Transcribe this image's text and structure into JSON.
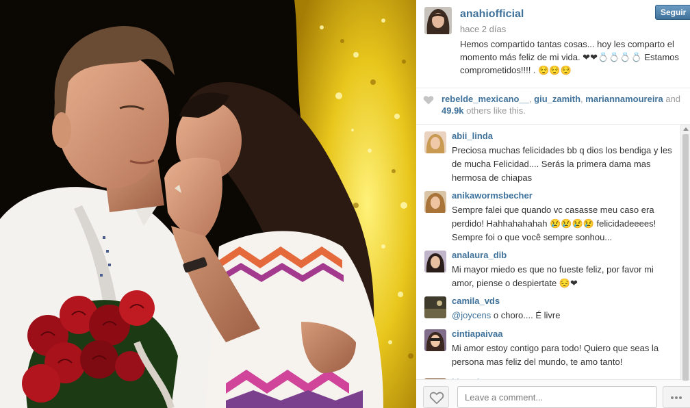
{
  "post": {
    "owner": "anahiofficial",
    "timestamp": "hace 2 días",
    "follow_label": "Seguir",
    "caption": "Hemos compartido tantas cosas... hoy les comparto el momento más feliz de mi vida. ❤❤💍💍💍💍 Estamos comprometidos!!!! . 😌😌😌"
  },
  "likes": {
    "likers": [
      "rebelde_mexicano__",
      "giu_zamith",
      "mariannamoureira"
    ],
    "separator": ", ",
    "and_text": " and ",
    "count": "49.9k",
    "suffix": " others like this."
  },
  "comments": [
    {
      "user": "abii_linda",
      "text": "Preciosa muchas felicidades bb q dios los bendiga y les de mucha Felicidad.... Serás la primera dama mas hermosa de chiapas"
    },
    {
      "user": "anikawormsbecher",
      "text": "Sempre falei que quando vc casasse meu caso era perdido! Hahhahahahah 😢😢😢😢 felicidadeeees! Sempre foi o que você sempre sonhou..."
    },
    {
      "user": "analaura_dib",
      "text": "Mi mayor miedo es que no fueste feliz, por favor mi amor, piense o despiertate 😔❤"
    },
    {
      "user": "camila_vds",
      "mention": "@joycens",
      "text": " o choro.... É livre"
    },
    {
      "user": "cintiapaivaa",
      "text": "Mi amor estoy contigo para todo! Quiero que seas la persona mas feliz del mundo, te amo tanto!"
    },
    {
      "user": "kimsalazarq",
      "text": ""
    }
  ],
  "footer": {
    "comment_placeholder": "Leave a comment..."
  },
  "icons": {
    "likes_heart": "heart-icon",
    "footer_like": "heart-icon",
    "footer_more": "ellipsis-icon"
  },
  "colors": {
    "link_blue": "#3f729b",
    "text": "#333333",
    "muted": "#9a9a9a",
    "follow_button": "#4f81ad"
  }
}
